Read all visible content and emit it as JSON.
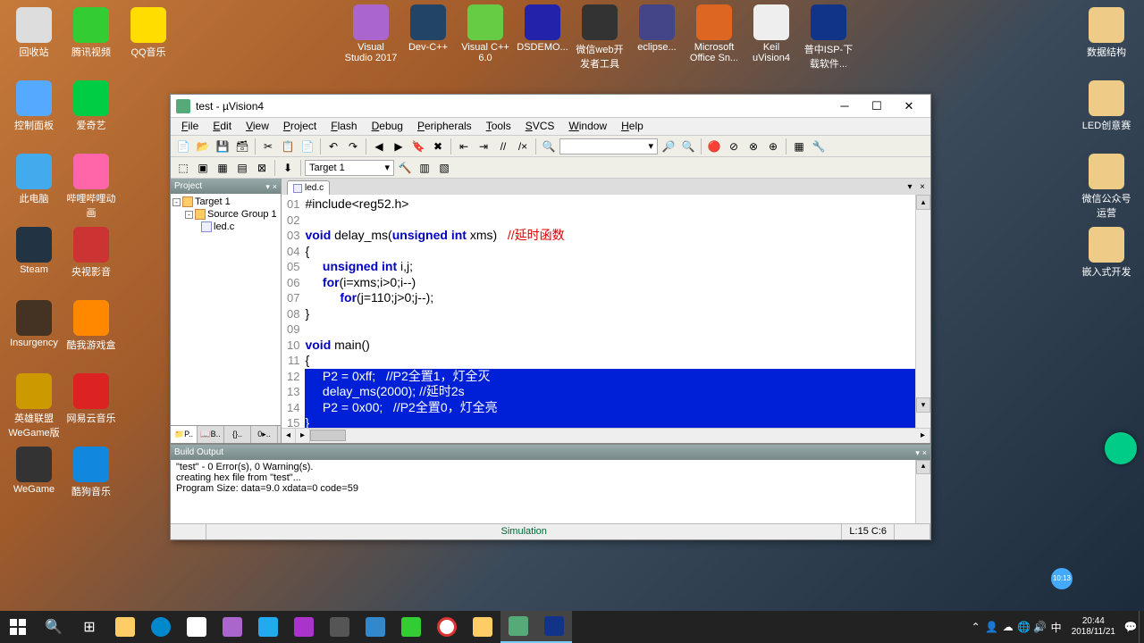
{
  "desktop_icons_left": [
    {
      "row": 0,
      "col": 0,
      "label": "回收站",
      "color": "#ddd"
    },
    {
      "row": 0,
      "col": 1,
      "label": "腾讯视频",
      "color": "#3c3"
    },
    {
      "row": 0,
      "col": 2,
      "label": "QQ音乐",
      "color": "#fd0"
    },
    {
      "row": 1,
      "col": 0,
      "label": "控制面板",
      "color": "#5af"
    },
    {
      "row": 1,
      "col": 1,
      "label": "爱奇艺",
      "color": "#0c4"
    },
    {
      "row": 2,
      "col": 0,
      "label": "此电脑",
      "color": "#4ae"
    },
    {
      "row": 2,
      "col": 1,
      "label": "哔哩哔哩动画",
      "color": "#f6a"
    },
    {
      "row": 3,
      "col": 0,
      "label": "Steam",
      "color": "#234"
    },
    {
      "row": 3,
      "col": 1,
      "label": "央视影音",
      "color": "#c33"
    },
    {
      "row": 4,
      "col": 0,
      "label": "Insurgency",
      "color": "#432"
    },
    {
      "row": 4,
      "col": 1,
      "label": "酷我游戏盒",
      "color": "#f80"
    },
    {
      "row": 5,
      "col": 0,
      "label": "英雄联盟WeGame版",
      "color": "#c90"
    },
    {
      "row": 5,
      "col": 1,
      "label": "网易云音乐",
      "color": "#d22"
    },
    {
      "row": 6,
      "col": 0,
      "label": "WeGame",
      "color": "#333"
    },
    {
      "row": 6,
      "col": 1,
      "label": "酷狗音乐",
      "color": "#18d"
    }
  ],
  "desktop_icons_top": [
    {
      "label": "Visual Studio 2017",
      "color": "#a6c"
    },
    {
      "label": "Dev-C++",
      "color": "#246"
    },
    {
      "label": "Visual C++ 6.0",
      "color": "#6c4"
    },
    {
      "label": "DSDEMO...",
      "color": "#22a"
    },
    {
      "label": "微信web开发者工具",
      "color": "#333"
    },
    {
      "label": "eclipse...",
      "color": "#448"
    },
    {
      "label": "Microsoft Office Sn...",
      "color": "#d62"
    },
    {
      "label": "Keil uVision4",
      "color": "#eee"
    },
    {
      "label": "普中ISP-下载软件...",
      "color": "#138"
    }
  ],
  "desktop_icons_right": [
    {
      "label": "数据结构",
      "color": "#ec8"
    },
    {
      "label": "LED创意赛",
      "color": "#ec8"
    },
    {
      "label": "微信公众号运营",
      "color": "#ec8"
    },
    {
      "label": "嵌入式开发",
      "color": "#ec8"
    }
  ],
  "window": {
    "title": "test - µVision4",
    "menus": [
      "File",
      "Edit",
      "View",
      "Project",
      "Flash",
      "Debug",
      "Peripherals",
      "Tools",
      "SVCS",
      "Window",
      "Help"
    ],
    "target_combo": "Target 1",
    "project_panel_title": "Project",
    "tree": {
      "root": "Target 1",
      "group": "Source Group 1",
      "file": "led.c"
    },
    "editor_tab": "led.c",
    "code": [
      {
        "n": "01",
        "t": "#include<reg52.h>",
        "plain": true
      },
      {
        "n": "02",
        "t": ""
      },
      {
        "n": "03",
        "kw1": "void",
        "mid": " delay_ms(",
        "kw2": "unsigned int",
        "mid2": " xms)   ",
        "cm": "//延时函数"
      },
      {
        "n": "04",
        "t": "{"
      },
      {
        "n": "05",
        "pre": "     ",
        "kw1": "unsigned int",
        "mid": " i,j;"
      },
      {
        "n": "06",
        "pre": "     ",
        "kw1": "for",
        "mid": "(i=xms;i>0;i--)"
      },
      {
        "n": "07",
        "pre": "          ",
        "kw1": "for",
        "mid": "(j=110;j>0;j--);"
      },
      {
        "n": "08",
        "t": "}"
      },
      {
        "n": "09",
        "t": ""
      },
      {
        "n": "10",
        "kw1": "void",
        "mid": " main()"
      },
      {
        "n": "11",
        "t": "{"
      },
      {
        "n": "12",
        "sel": true,
        "t": "     P2 = 0xff;   //P2全置1，灯全灭"
      },
      {
        "n": "13",
        "sel": true,
        "t": "     delay_ms(2000); //延时2s"
      },
      {
        "n": "14",
        "sel": true,
        "t": "     P2 = 0x00;   //P2全置0，灯全亮"
      },
      {
        "n": "15",
        "sel": true,
        "t": "}"
      }
    ],
    "build_panel_title": "Build Output",
    "build_output": [
      "Program Size: data=9.0 xdata=0 code=59",
      "creating hex file from \"test\"...",
      "\"test\" - 0 Error(s), 0 Warning(s)."
    ],
    "status": {
      "sim": "Simulation",
      "pos": "L:15 C:6"
    }
  },
  "taskbar": {
    "time": "20:44",
    "date": "2018/11/21",
    "ime": "中"
  },
  "float_clock": "10:13"
}
